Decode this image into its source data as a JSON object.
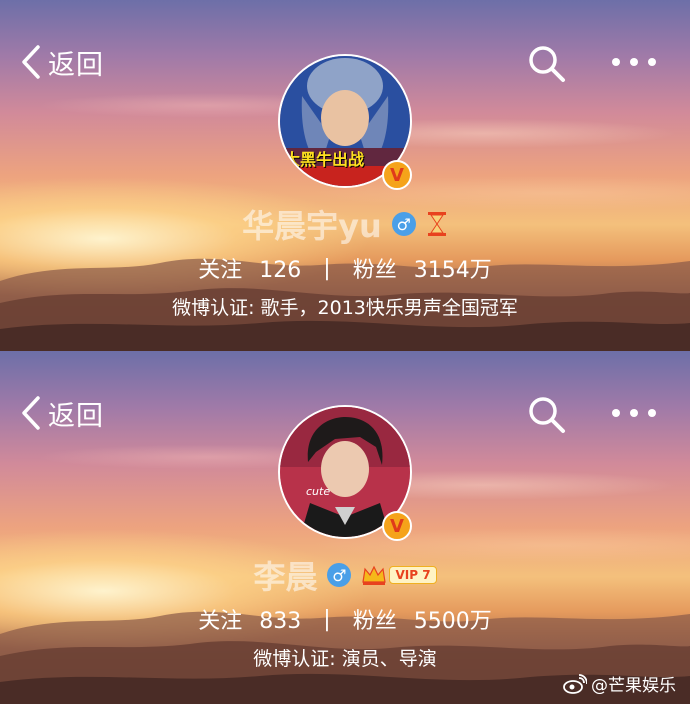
{
  "panels": [
    {
      "back_label": "返回",
      "name": "华晨宇yu",
      "avatar_caption": "大黑牛出战",
      "follow_label": "关注",
      "follow_count": "126",
      "separator": "|",
      "fans_label": "粉丝",
      "fans_count": "3154万",
      "certification": "微博认证: 歌手，2013快乐男声全国冠军",
      "badge_icon": "hourglass-icon"
    },
    {
      "back_label": "返回",
      "name": "李晨",
      "avatar_caption": "cute",
      "follow_label": "关注",
      "follow_count": "833",
      "separator": "|",
      "fans_label": "粉丝",
      "fans_count": "5500万",
      "certification": "微博认证: 演员、导演",
      "badge_icon": "vip-crown-icon",
      "vip_label": "VIP 7"
    }
  ],
  "verified_mark": "V",
  "gender_symbol": "♂",
  "watermark": "@芒果娱乐",
  "colors": {
    "verified_badge": "#f5a31a",
    "gender_badge": "#4a9fe8",
    "vip_text": "#e8421e"
  }
}
